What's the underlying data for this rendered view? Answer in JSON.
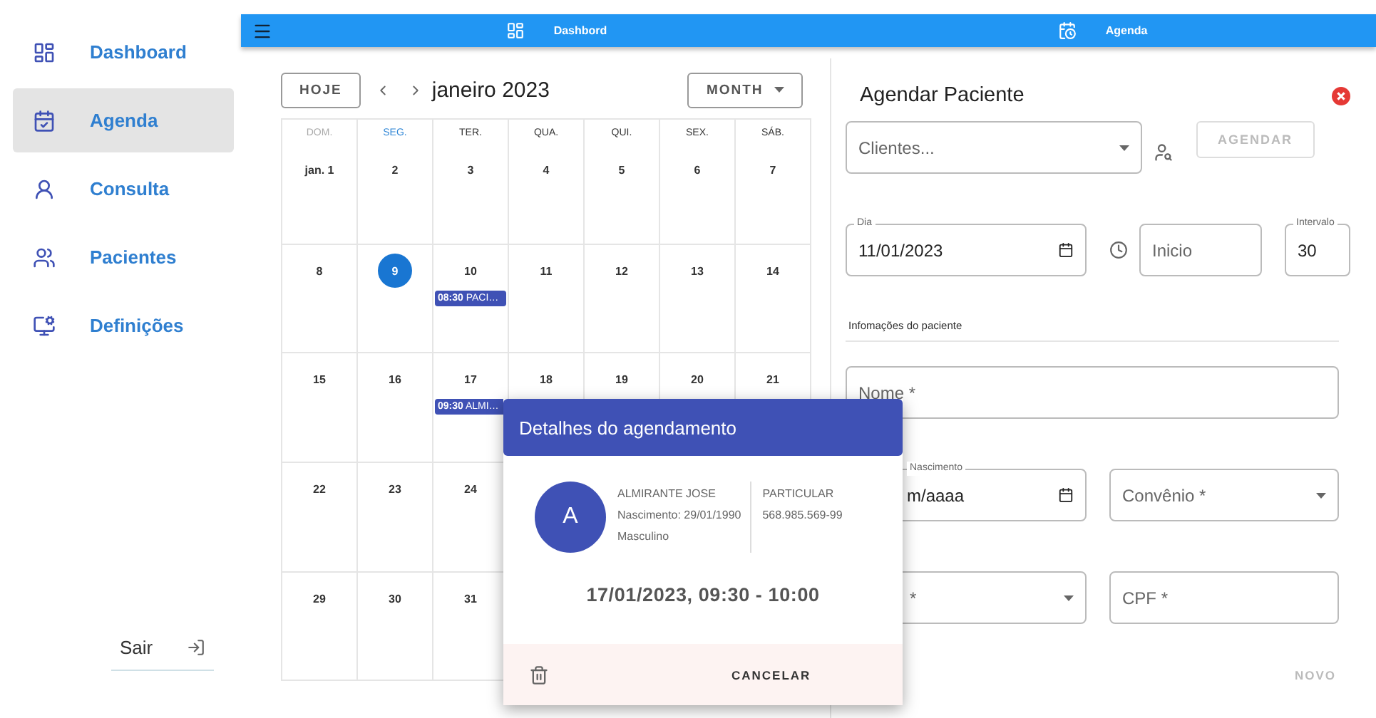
{
  "sidebar": {
    "items": [
      {
        "label": "Dashboard",
        "selected": false
      },
      {
        "label": "Agenda",
        "selected": true
      },
      {
        "label": "Consulta",
        "selected": false
      },
      {
        "label": "Pacientes",
        "selected": false
      },
      {
        "label": "Definições",
        "selected": false
      }
    ],
    "logout_button": "Sair"
  },
  "top_bar": {
    "tabs": [
      {
        "label": "Dashbord"
      },
      {
        "label": "Agenda"
      }
    ]
  },
  "calendar": {
    "today_button": "HOJE",
    "title": "janeiro 2023",
    "view_button": "MONTH",
    "weekdays": [
      {
        "label": "DOM.",
        "kind": "weekend"
      },
      {
        "label": "SEG.",
        "kind": "today"
      },
      {
        "label": "TER.",
        "kind": "normal"
      },
      {
        "label": "QUA.",
        "kind": "normal"
      },
      {
        "label": "QUI.",
        "kind": "normal"
      },
      {
        "label": "SEX.",
        "kind": "normal"
      },
      {
        "label": "SÁB.",
        "kind": "normal"
      }
    ],
    "weeks": [
      [
        {
          "day": "jan. 1",
          "selected": false
        },
        {
          "day": "2",
          "selected": false
        },
        {
          "day": "3",
          "selected": false
        },
        {
          "day": "4",
          "selected": false
        },
        {
          "day": "5",
          "selected": false
        },
        {
          "day": "6",
          "selected": false
        },
        {
          "day": "7",
          "selected": false
        }
      ],
      [
        {
          "day": "8",
          "selected": false
        },
        {
          "day": "9",
          "selected": true
        },
        {
          "day": "10",
          "selected": false,
          "events": [
            {
              "time": "08:30",
              "title": "PACI…"
            }
          ]
        },
        {
          "day": "11",
          "selected": false
        },
        {
          "day": "12",
          "selected": false
        },
        {
          "day": "13",
          "selected": false
        },
        {
          "day": "14",
          "selected": false
        }
      ],
      [
        {
          "day": "15",
          "selected": false
        },
        {
          "day": "16",
          "selected": false
        },
        {
          "day": "17",
          "selected": false,
          "events": [
            {
              "time": "09:30",
              "title": "ALMI…"
            }
          ]
        },
        {
          "day": "18",
          "selected": false
        },
        {
          "day": "19",
          "selected": false
        },
        {
          "day": "20",
          "selected": false
        },
        {
          "day": "21",
          "selected": false
        }
      ],
      [
        {
          "day": "22",
          "selected": false
        },
        {
          "day": "23",
          "selected": false
        },
        {
          "day": "24",
          "selected": false
        }
      ],
      [
        {
          "day": "29",
          "selected": false
        },
        {
          "day": "30",
          "selected": false
        },
        {
          "day": "31",
          "selected": false
        }
      ]
    ]
  },
  "form": {
    "title": "Agendar Paciente",
    "client_select": {
      "placeholder": "Clientes..."
    },
    "schedule_button": {
      "label": "AGENDAR",
      "disabled": true
    },
    "day_field": {
      "label": "Dia",
      "value": "11/01/2023"
    },
    "start_field": {
      "placeholder": "Inicio"
    },
    "interval_field": {
      "label": "Intervalo",
      "value": "30"
    },
    "section_title": "Infomações do paciente",
    "name_field": {
      "placeholder": "Nome *"
    },
    "birth_field": {
      "label": "Nascimento",
      "value": "m/aaaa"
    },
    "insurance_select": {
      "placeholder": "Convênio *"
    },
    "select_3": {
      "placeholder": "*"
    },
    "cpf_field": {
      "placeholder": "CPF *"
    },
    "new_button": {
      "label": "NOVO",
      "disabled": true
    }
  },
  "popup": {
    "title": "Detalhes do agendamento",
    "avatar": "A",
    "patient_name": "ALMIRANTE JOSE",
    "birth": "Nascimento: 29/01/1990",
    "gender": "Masculino",
    "plan": "PARTICULAR",
    "document": "568.985.569-99",
    "when": "17/01/2023, 09:30 - 10:00",
    "cancel_button": "CANCELAR"
  }
}
